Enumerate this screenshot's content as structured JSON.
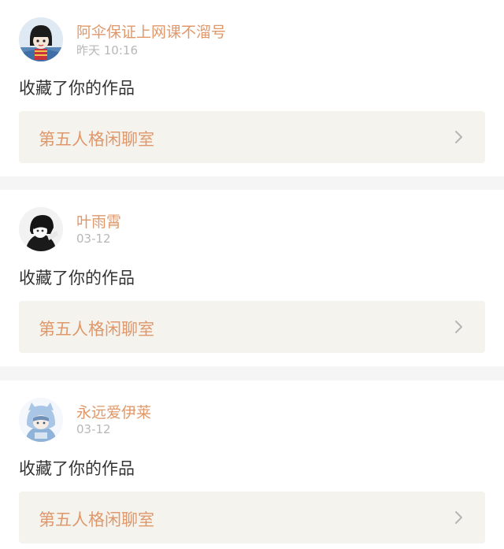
{
  "notifications": [
    {
      "username": "阿伞保证上网课不溜号",
      "timestamp": "昨天 10:16",
      "action": "收藏了你的作品",
      "work_title": "第五人格闲聊室",
      "avatar_icon": "cartoon-girl-avatar"
    },
    {
      "username": "叶雨霄",
      "timestamp": "03-12",
      "action": "收藏了你的作品",
      "work_title": "第五人格闲聊室",
      "avatar_icon": "dark-anime-avatar"
    },
    {
      "username": "永远爱伊莱",
      "timestamp": "03-12",
      "action": "收藏了你的作品",
      "work_title": "第五人格闲聊室",
      "avatar_icon": "blue-owl-hood-avatar"
    }
  ],
  "colors": {
    "accent": "#e0986a",
    "muted": "#b8b8b8",
    "text": "#333333",
    "link_bg": "#f4f3ee",
    "divider_bg": "#f5f5f5"
  }
}
